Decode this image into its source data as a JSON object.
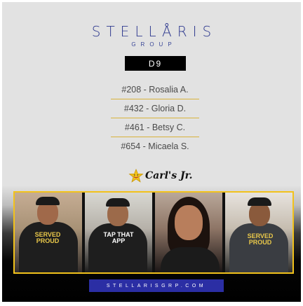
{
  "brand": {
    "name": "STELLÅRIS",
    "sub": "GROUP"
  },
  "badge": "D9",
  "list": [
    "#208 - Rosalia A.",
    "#432 - Gloria D.",
    "#461 - Betsy C.",
    "#654 - Micaela S."
  ],
  "logo": {
    "text": "Carl's Jr.",
    "icon": "star-icon",
    "icon_color": "#f2c21b"
  },
  "photos": [
    {
      "name": "photo-rosalia",
      "shirt": "SERVED PROUD"
    },
    {
      "name": "photo-gloria",
      "shirt": "TAP THAT APP"
    },
    {
      "name": "photo-betsy",
      "shirt": ""
    },
    {
      "name": "photo-micaela",
      "shirt": "SERVED PROUD"
    }
  ],
  "website": "STELLARISGRP.COM",
  "colors": {
    "brand": "#2f3a8f",
    "accent": "#f2c21b",
    "website_bg": "#2b2ea4"
  }
}
